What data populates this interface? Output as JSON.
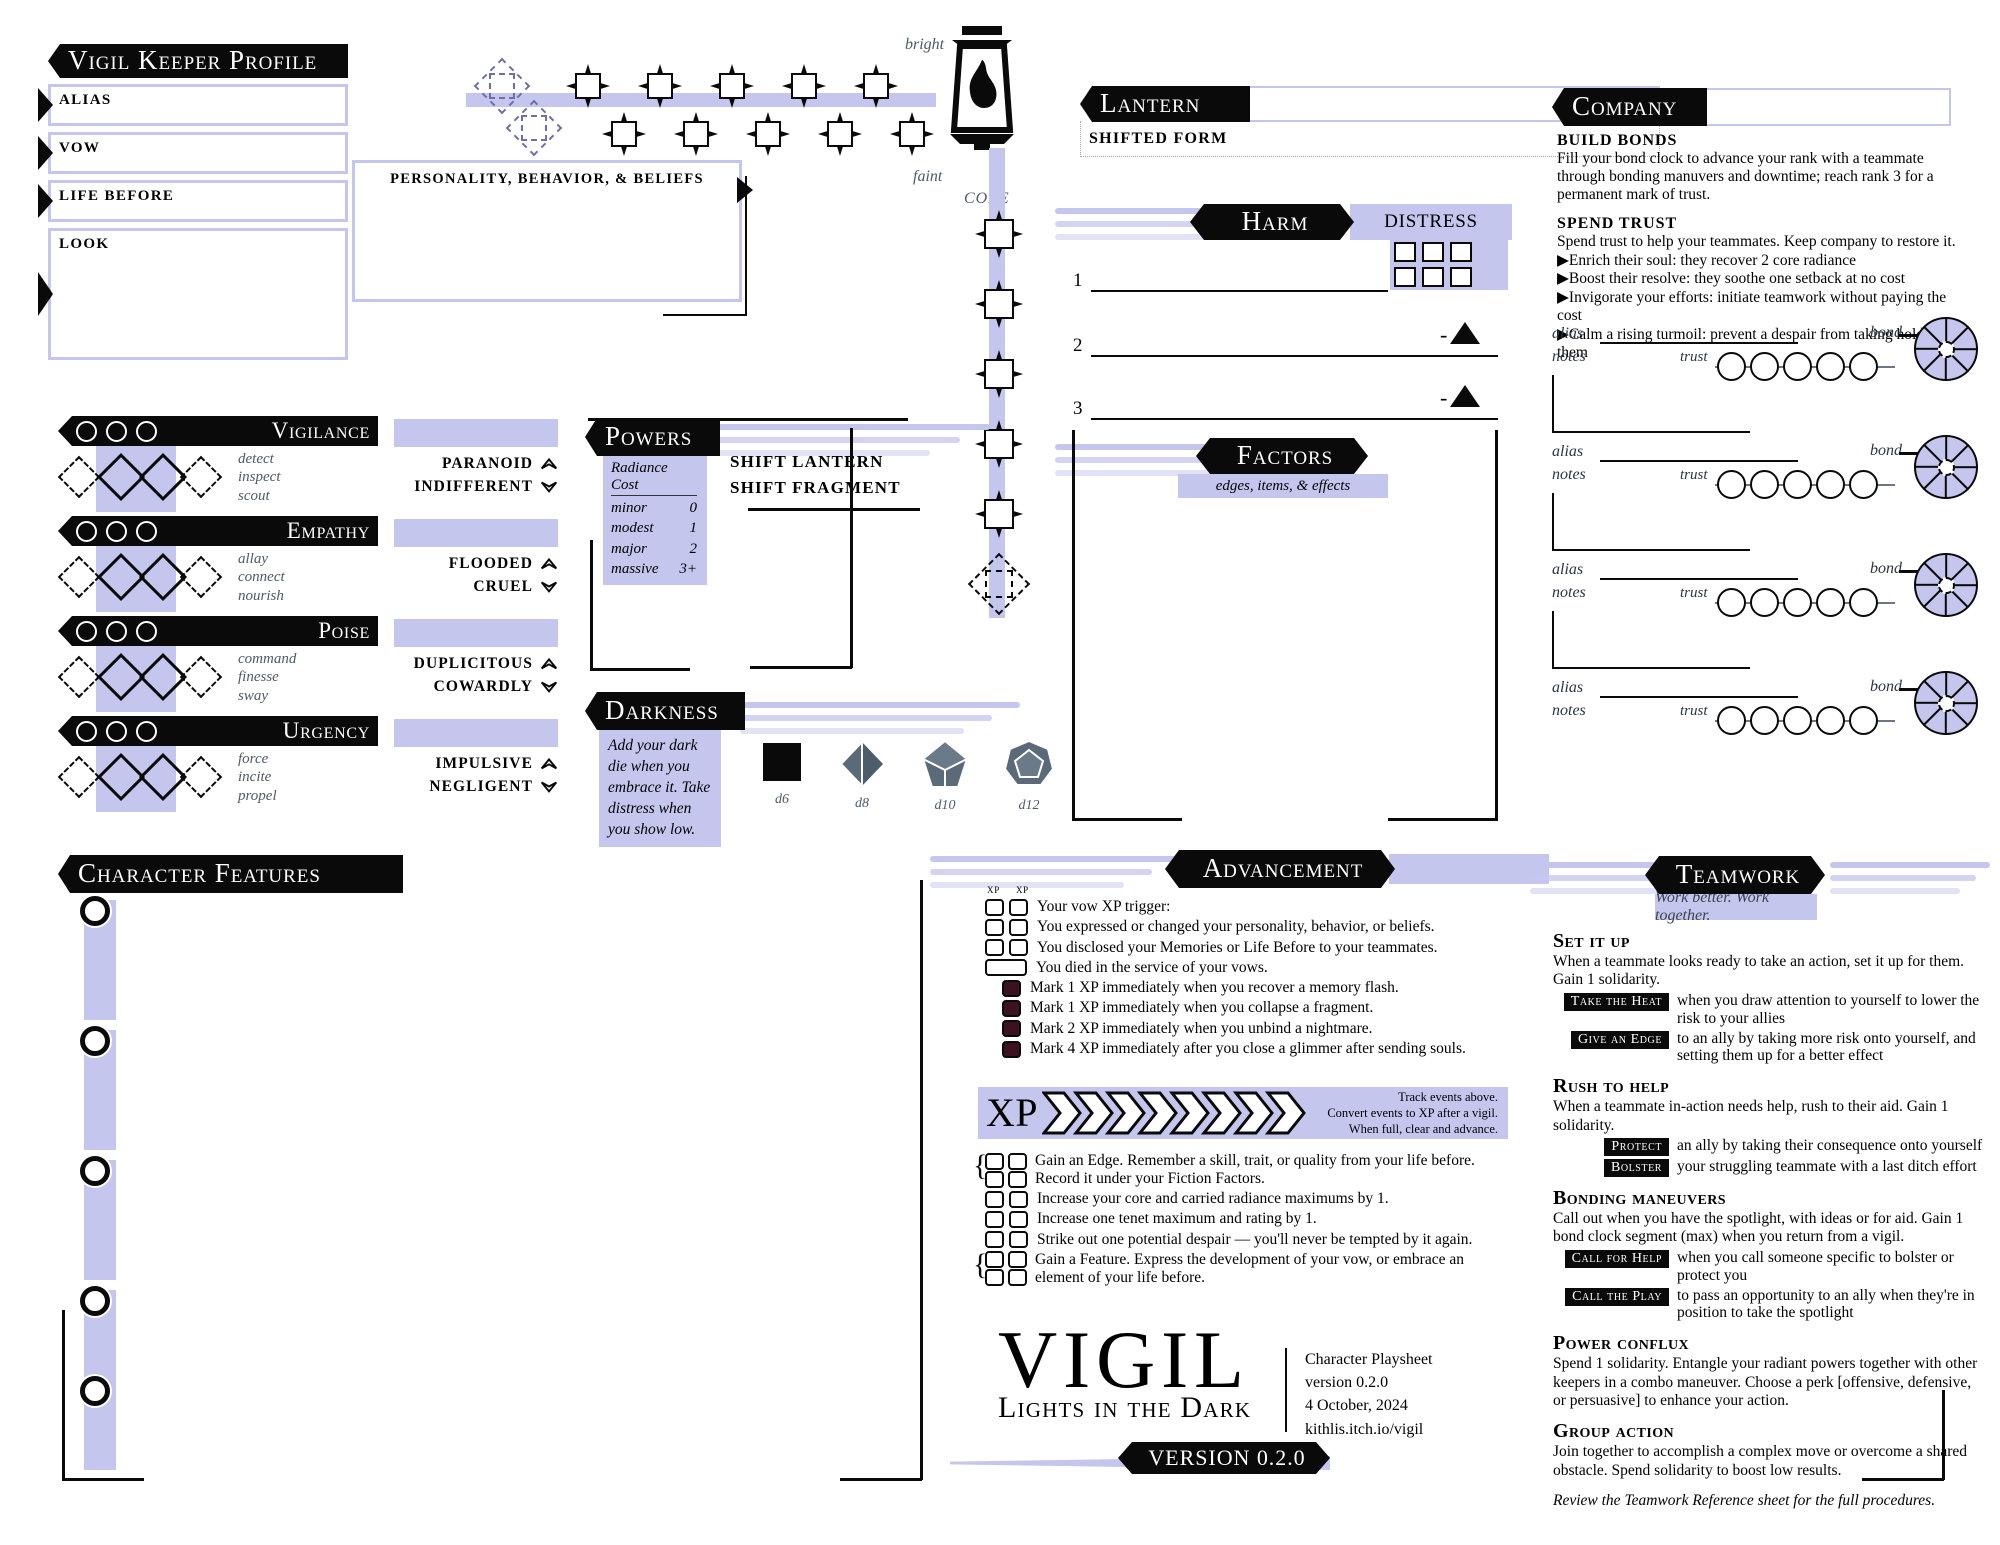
{
  "profile": {
    "title": "Vigil Keeper Profile",
    "fields": [
      {
        "label": "ALIAS"
      },
      {
        "label": "VOW"
      },
      {
        "label": "LIFE BEFORE"
      },
      {
        "label": "LOOK"
      }
    ],
    "pbb_label": "PERSONALITY, BEHAVIOR, & BELIEFS"
  },
  "radiance": {
    "bright_label": "bright",
    "faint_label": "faint",
    "core_label": "CORE"
  },
  "lantern": {
    "title": "Lantern",
    "shifted_form_label": "SHIFTED FORM"
  },
  "harm": {
    "title": "Harm",
    "distress_label": "DISTRESS",
    "rows": [
      "1",
      "2",
      "3"
    ]
  },
  "factors": {
    "title": "Factors",
    "subtitle": "edges, items, & effects"
  },
  "attributes": [
    {
      "name": "Vigilance",
      "tenets": [
        "detect",
        "inspect",
        "scout"
      ],
      "despairs": [
        "PARANOID",
        "INDIFFERENT"
      ]
    },
    {
      "name": "Empathy",
      "tenets": [
        "allay",
        "connect",
        "nourish"
      ],
      "despairs": [
        "FLOODED",
        "CRUEL"
      ]
    },
    {
      "name": "Poise",
      "tenets": [
        "command",
        "finesse",
        "sway"
      ],
      "despairs": [
        "DUPLICITOUS",
        "COWARDLY"
      ]
    },
    {
      "name": "Urgency",
      "tenets": [
        "force",
        "incite",
        "propel"
      ],
      "despairs": [
        "IMPULSIVE",
        "NEGLIGENT"
      ]
    }
  ],
  "powers": {
    "title": "Powers",
    "cost_header": "Radiance Cost",
    "costs": [
      {
        "name": "minor",
        "value": "0"
      },
      {
        "name": "modest",
        "value": "1"
      },
      {
        "name": "major",
        "value": "2"
      },
      {
        "name": "massive",
        "value": "3+"
      }
    ],
    "shifts": [
      "SHIFT LANTERN",
      "SHIFT FRAGMENT"
    ]
  },
  "darkness": {
    "title": "Darkness",
    "text": "Add your dark die when you embrace it. Take distress when you show low.",
    "dice": [
      "d6",
      "d8",
      "d10",
      "d12"
    ]
  },
  "character_features": {
    "title": "Character Features",
    "slots": 5
  },
  "company": {
    "title": "Company",
    "build_bonds_heading": "BUILD BONDS",
    "build_bonds_text": "Fill your bond clock to advance your rank with a teammate through bonding manuvers and downtime; reach rank 3 for a permanent mark of trust.",
    "spend_trust_heading": "SPEND TRUST",
    "spend_trust_text": "Spend trust to help your teammates. Keep company to restore it.",
    "spend_trust_items": [
      "Enrich their soul: they recover 2 core radiance",
      "Boost their resolve: they soothe one setback at no cost",
      "Invigorate your efforts: initiate teamwork without paying the cost",
      "Calm a rising turmoil: prevent a despair from taking hold of them"
    ],
    "row_labels": {
      "alias": "alias",
      "notes": "notes",
      "trust": "trust",
      "bond": "bond"
    },
    "row_count": 4,
    "trust_circles": 5,
    "bond_segments": 8
  },
  "advancement": {
    "title": "Advancement",
    "xp_tick_label": "XP",
    "events": [
      {
        "boxes": 2,
        "text": "Your vow XP trigger:"
      },
      {
        "boxes": 2,
        "text": "You expressed or changed your personality, behavior, or beliefs."
      },
      {
        "boxes": 2,
        "text": "You disclosed your Memories or Life Before to your teammates."
      },
      {
        "boxes": 1,
        "wide": true,
        "text": "You died in the service of your vows."
      },
      {
        "boxes": 1,
        "filled": true,
        "text": "Mark 1 XP immediately when you recover a memory flash."
      },
      {
        "boxes": 1,
        "filled": true,
        "text": "Mark 1 XP immediately when you collapse a fragment."
      },
      {
        "boxes": 1,
        "filled": true,
        "text": "Mark 2 XP immediately when you unbind a nightmare."
      },
      {
        "boxes": 1,
        "filled": true,
        "text": "Mark 4 XP immediately after you close a glimmer after sending souls."
      }
    ],
    "xp_label": "XP",
    "xp_slots": 8,
    "xp_note": [
      "Track events above.",
      "Convert events to XP after a vigil.",
      "When full, clear and advance."
    ],
    "upgrades": [
      {
        "rows": 2,
        "lines": [
          "Gain an Edge. Remember a skill, trait, or quality from your life before.",
          "Record it under your Fiction Factors."
        ],
        "brace": true
      },
      {
        "rows": 1,
        "lines": [
          "Increase your core and carried radiance maximums by 1."
        ]
      },
      {
        "rows": 1,
        "lines": [
          "Increase one tenet maximum and rating by 1."
        ]
      },
      {
        "rows": 1,
        "lines": [
          "Strike out one potential despair — you'll never be tempted by it again."
        ]
      },
      {
        "rows": 2,
        "lines": [
          "Gain a Feature. Express the development of your vow, or embrace an",
          "element of your life before."
        ],
        "brace": true
      }
    ]
  },
  "logo": {
    "title": "VIGIL",
    "subtitle": "Lights in the Dark",
    "version_banner": "VERSION 0.2.0",
    "meta": [
      "Character Playsheet",
      "version 0.2.0",
      "4 October, 2024",
      "kithlis.itch.io/vigil"
    ]
  },
  "teamwork": {
    "title": "Teamwork",
    "tagline": "Work better. Work together.",
    "sections": [
      {
        "heading": "Set it up",
        "body": "When a teammate looks ready to take an action, set it up for them. Gain 1 solidarity.",
        "moves": [
          {
            "tag": "Take the Heat",
            "text": "when you draw attention to yourself to lower the risk to your allies"
          },
          {
            "tag": "Give an Edge",
            "text": "to an ally by taking more risk onto yourself, and setting them up for a better effect"
          }
        ]
      },
      {
        "heading": "Rush to help",
        "body": "When a teammate in-action needs help, rush to their aid. Gain 1 solidarity.",
        "moves": [
          {
            "tag": "Protect",
            "text": "an ally by taking their consequence onto yourself"
          },
          {
            "tag": "Bolster",
            "text": "your struggling teammate with a last ditch effort"
          }
        ]
      },
      {
        "heading": "Bonding maneuvers",
        "body": "Call out when you have the spotlight, with ideas or for aid. Gain 1 bond clock segment (max) when you return from a vigil.",
        "moves": [
          {
            "tag": "Call for Help",
            "text": "when you call someone specific to bolster or protect you"
          },
          {
            "tag": "Call the Play",
            "text": "to pass an opportunity to an ally when they're in position to take the spotlight"
          }
        ]
      },
      {
        "heading": "Power conflux",
        "body": "Spend 1 solidarity. Entangle your radiant powers together with other keepers in a combo maneuver. Choose a perk [offensive, defensive, or persuasive] to enhance your action.",
        "moves": []
      },
      {
        "heading": "Group action",
        "body": "Join together to accomplish a complex move or overcome a shared obstacle. Spend solidarity to boost low results.",
        "moves": []
      }
    ],
    "footer_note": "Review the Teamwork Reference sheet for the full procedures."
  },
  "colors": {
    "lavender": "#c5c6ee",
    "ink": "#0a0a0a",
    "slate": "#4e5a68",
    "maroon": "#3d1220"
  }
}
